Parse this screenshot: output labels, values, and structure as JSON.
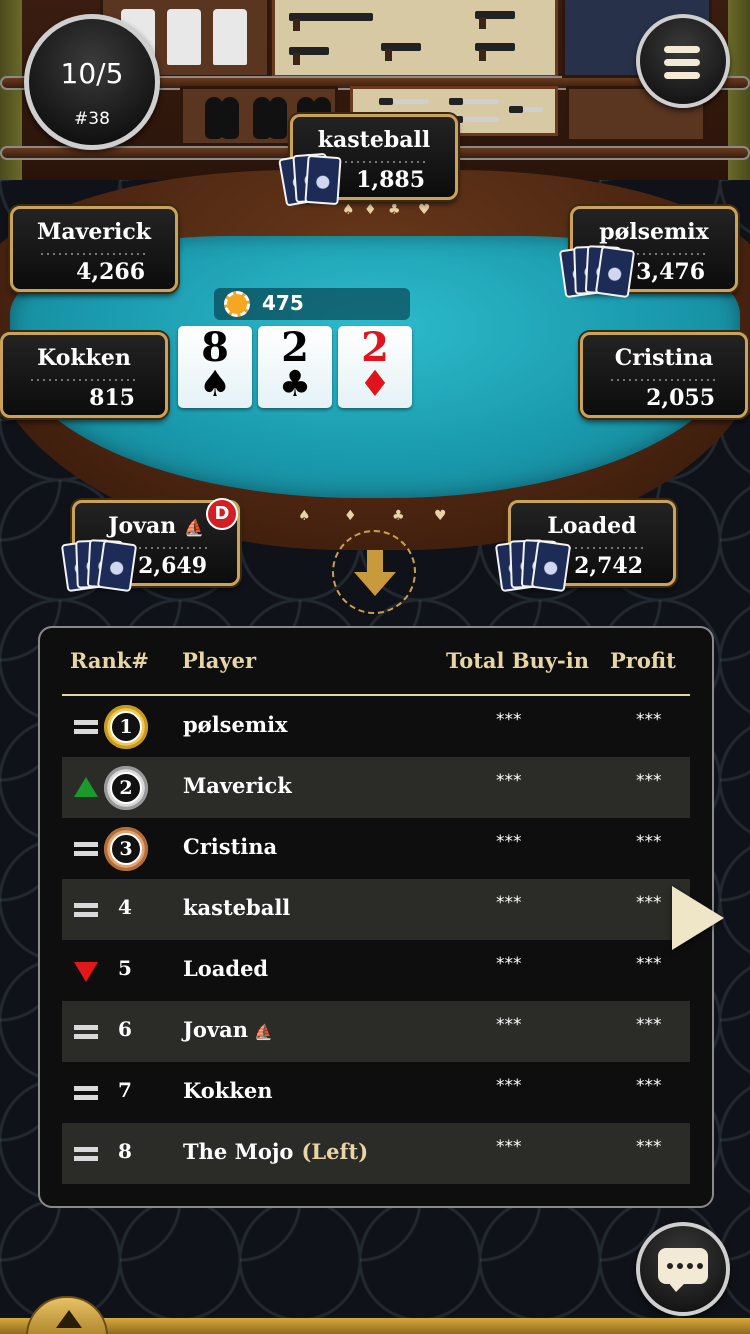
{
  "round": {
    "hand_count": "10/5",
    "table_number": "#38"
  },
  "seats": [
    {
      "name": "kasteball",
      "chips": "1,885"
    },
    {
      "name": "Maverick",
      "chips": "4,266"
    },
    {
      "name": "pølsemix",
      "chips": "3,476"
    },
    {
      "name": "Kokken",
      "chips": "815"
    },
    {
      "name": "Cristina",
      "chips": "2,055"
    },
    {
      "name": "Jovan",
      "chips": "2,649"
    },
    {
      "name": "Loaded",
      "chips": "2,742"
    }
  ],
  "dealer_label": "D",
  "pot": {
    "amount": "475"
  },
  "board_cards": [
    {
      "rank": "8",
      "suit": "♠",
      "color": "#000000"
    },
    {
      "rank": "2",
      "suit": "♣",
      "color": "#000000"
    },
    {
      "rank": "2",
      "suit": "♦",
      "color": "#e0141c"
    }
  ],
  "rail_decor": [
    "♠",
    "♦",
    "♣",
    "♥"
  ],
  "leaderboard": {
    "headers": {
      "rank": "Rank#",
      "player": "Player",
      "buyin": "Total Buy-in",
      "profit": "Profit"
    },
    "rows": [
      {
        "rank": "1",
        "move": "same",
        "player": "pølsemix",
        "buyin": "***",
        "profit": "***"
      },
      {
        "rank": "2",
        "move": "up",
        "player": "Maverick",
        "buyin": "***",
        "profit": "***"
      },
      {
        "rank": "3",
        "move": "same",
        "player": "Cristina",
        "buyin": "***",
        "profit": "***"
      },
      {
        "rank": "4",
        "move": "same",
        "player": "kasteball",
        "buyin": "***",
        "profit": "***"
      },
      {
        "rank": "5",
        "move": "down",
        "player": "Loaded",
        "buyin": "***",
        "profit": "***"
      },
      {
        "rank": "6",
        "move": "same",
        "player": "Jovan",
        "buyin": "***",
        "profit": "***"
      },
      {
        "rank": "7",
        "move": "same",
        "player": "Kokken",
        "buyin": "***",
        "profit": "***"
      },
      {
        "rank": "8",
        "move": "same",
        "player": "The Mojo",
        "tag": "(Left)",
        "buyin": "***",
        "profit": "***"
      }
    ]
  },
  "icons": {
    "menu": "hamburger-icon",
    "chat": "chat-bubble-icon",
    "down": "down-arrow-icon",
    "next": "next-arrow-icon",
    "boat": "boat-icon"
  },
  "colors": {
    "felt": "#1a9aad",
    "seat_border": "#caa25c",
    "header_text": "#e8d5a6",
    "move_up": "#1a9a2a",
    "move_down": "#e01818"
  }
}
